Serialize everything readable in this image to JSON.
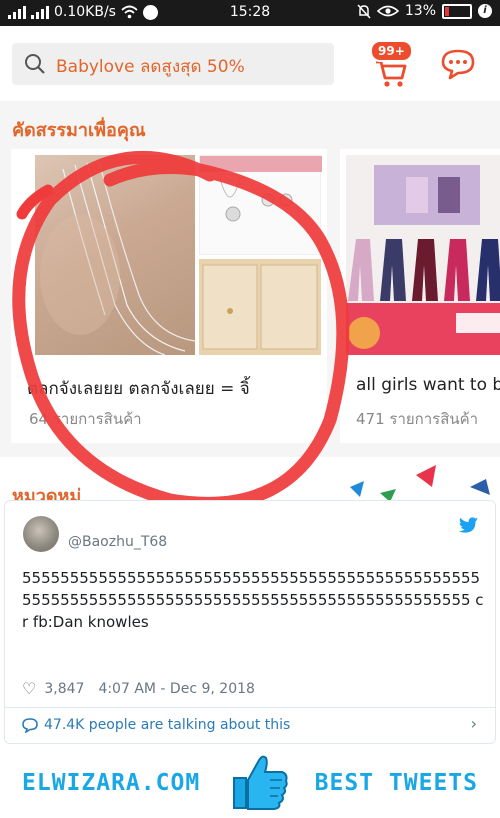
{
  "status_bar": {
    "network_speed": "0.10KB/s",
    "time": "15:28",
    "battery": "13%",
    "battery_color": "#e53935"
  },
  "header": {
    "search_text": "Babylove ลดสูงสุด 50%",
    "cart_badge": "99+",
    "accent_color": "#ee4d2d"
  },
  "recommended": {
    "title": "คัดสรรมาเพื่อคุณ",
    "cards": [
      {
        "title": "ตลกจังเลยยย ตลกจังเลยย = จิ้",
        "count": "64 รายการสินค้า"
      },
      {
        "title": "all girls want to b",
        "count": "471 รายการสินค้า"
      }
    ]
  },
  "categories": {
    "title": "หมวดหมู่"
  },
  "tweet": {
    "display_name": "",
    "handle": "@Baozhu_T68",
    "text": "55555555555555555555555555555555555555555555555555555555555555555555555555555555555555555555555 cr fb:Dan knowles",
    "likes": "3,847",
    "timestamp": "4:07 AM - Dec 9, 2018",
    "talking": "47.4K people are talking about this",
    "link_color": "#2b7bb9"
  },
  "footer": {
    "left_text": "ELWIZARA.COM",
    "right_text": "BEST TWEETS",
    "brand_color": "#1aa7e6"
  }
}
